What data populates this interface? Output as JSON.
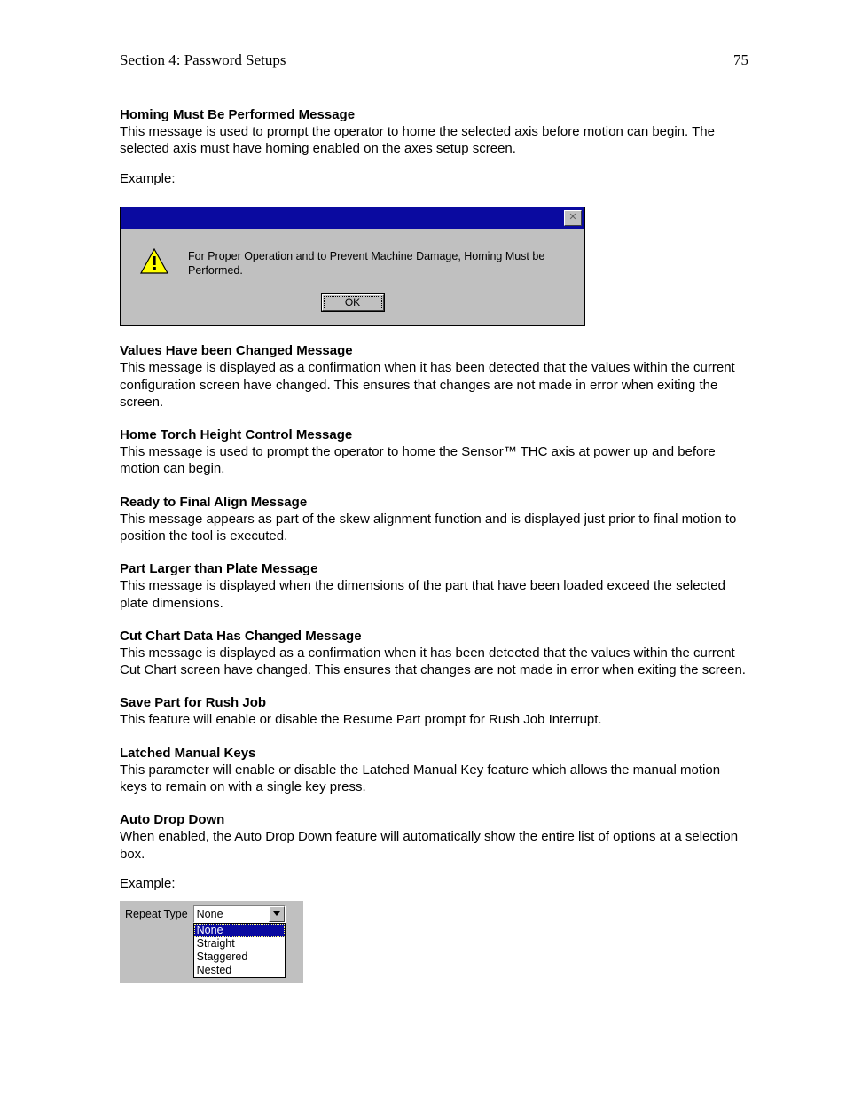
{
  "header": {
    "section": "Section 4: Password Setups",
    "page_number": "75"
  },
  "sections": [
    {
      "title": "Homing Must Be Performed Message",
      "body": "This message is used to prompt the operator to home the selected axis before motion can begin. The selected axis must have homing enabled on the axes setup screen."
    },
    {
      "title": "Values Have been Changed Message",
      "body": "This message is displayed as a confirmation when it has been detected that the values within the current configuration screen have changed.  This ensures that changes are not made in error when exiting the screen."
    },
    {
      "title": "Home Torch Height Control Message",
      "body": "This message is used to prompt the operator to home the Sensor™ THC axis at power up and before motion can begin."
    },
    {
      "title": "Ready to Final Align Message",
      "body": "This message appears as part of the skew alignment function and is displayed just prior to final motion to position the tool is executed."
    },
    {
      "title": "Part Larger than Plate Message",
      "body": "This message is displayed when the dimensions of the part that have been loaded exceed the selected plate dimensions."
    },
    {
      "title": "Cut Chart Data Has Changed Message",
      "body": "This message is displayed as a confirmation when it has been detected that the values within the current Cut Chart screen have changed.  This ensures that changes are not made in error when exiting the screen."
    },
    {
      "title": "Save Part for Rush Job",
      "body": "This feature will enable or disable the Resume Part prompt for Rush Job Interrupt."
    },
    {
      "title": "Latched Manual Keys",
      "body": "This parameter will enable or disable the Latched Manual Key feature which allows the manual motion keys to remain on with a single key press."
    },
    {
      "title": "Auto Drop Down",
      "body": "When enabled, the Auto Drop Down feature will automatically show the entire list of options at a selection box."
    }
  ],
  "example_label": "Example:",
  "dialog": {
    "message": "For Proper Operation and to Prevent Machine Damage, Homing Must be Performed.",
    "ok_label": "OK",
    "close_label": "✕"
  },
  "dropdown": {
    "label": "Repeat Type",
    "value": "None",
    "options": [
      "None",
      "Straight",
      "Staggered",
      "Nested"
    ],
    "selected_index": 0
  }
}
